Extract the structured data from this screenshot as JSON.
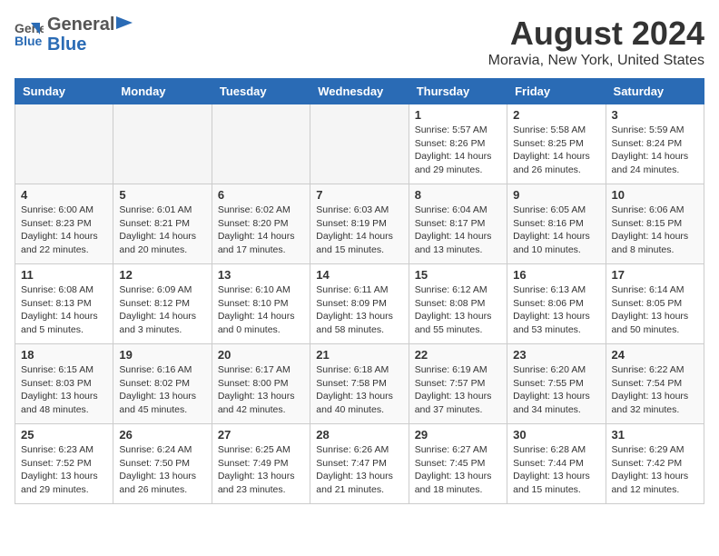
{
  "header": {
    "logo_general": "General",
    "logo_blue": "Blue",
    "month": "August 2024",
    "location": "Moravia, New York, United States"
  },
  "days_of_week": [
    "Sunday",
    "Monday",
    "Tuesday",
    "Wednesday",
    "Thursday",
    "Friday",
    "Saturday"
  ],
  "weeks": [
    [
      {
        "day": "",
        "info": ""
      },
      {
        "day": "",
        "info": ""
      },
      {
        "day": "",
        "info": ""
      },
      {
        "day": "",
        "info": ""
      },
      {
        "day": "1",
        "info": "Sunrise: 5:57 AM\nSunset: 8:26 PM\nDaylight: 14 hours\nand 29 minutes."
      },
      {
        "day": "2",
        "info": "Sunrise: 5:58 AM\nSunset: 8:25 PM\nDaylight: 14 hours\nand 26 minutes."
      },
      {
        "day": "3",
        "info": "Sunrise: 5:59 AM\nSunset: 8:24 PM\nDaylight: 14 hours\nand 24 minutes."
      }
    ],
    [
      {
        "day": "4",
        "info": "Sunrise: 6:00 AM\nSunset: 8:23 PM\nDaylight: 14 hours\nand 22 minutes."
      },
      {
        "day": "5",
        "info": "Sunrise: 6:01 AM\nSunset: 8:21 PM\nDaylight: 14 hours\nand 20 minutes."
      },
      {
        "day": "6",
        "info": "Sunrise: 6:02 AM\nSunset: 8:20 PM\nDaylight: 14 hours\nand 17 minutes."
      },
      {
        "day": "7",
        "info": "Sunrise: 6:03 AM\nSunset: 8:19 PM\nDaylight: 14 hours\nand 15 minutes."
      },
      {
        "day": "8",
        "info": "Sunrise: 6:04 AM\nSunset: 8:17 PM\nDaylight: 14 hours\nand 13 minutes."
      },
      {
        "day": "9",
        "info": "Sunrise: 6:05 AM\nSunset: 8:16 PM\nDaylight: 14 hours\nand 10 minutes."
      },
      {
        "day": "10",
        "info": "Sunrise: 6:06 AM\nSunset: 8:15 PM\nDaylight: 14 hours\nand 8 minutes."
      }
    ],
    [
      {
        "day": "11",
        "info": "Sunrise: 6:08 AM\nSunset: 8:13 PM\nDaylight: 14 hours\nand 5 minutes."
      },
      {
        "day": "12",
        "info": "Sunrise: 6:09 AM\nSunset: 8:12 PM\nDaylight: 14 hours\nand 3 minutes."
      },
      {
        "day": "13",
        "info": "Sunrise: 6:10 AM\nSunset: 8:10 PM\nDaylight: 14 hours\nand 0 minutes."
      },
      {
        "day": "14",
        "info": "Sunrise: 6:11 AM\nSunset: 8:09 PM\nDaylight: 13 hours\nand 58 minutes."
      },
      {
        "day": "15",
        "info": "Sunrise: 6:12 AM\nSunset: 8:08 PM\nDaylight: 13 hours\nand 55 minutes."
      },
      {
        "day": "16",
        "info": "Sunrise: 6:13 AM\nSunset: 8:06 PM\nDaylight: 13 hours\nand 53 minutes."
      },
      {
        "day": "17",
        "info": "Sunrise: 6:14 AM\nSunset: 8:05 PM\nDaylight: 13 hours\nand 50 minutes."
      }
    ],
    [
      {
        "day": "18",
        "info": "Sunrise: 6:15 AM\nSunset: 8:03 PM\nDaylight: 13 hours\nand 48 minutes."
      },
      {
        "day": "19",
        "info": "Sunrise: 6:16 AM\nSunset: 8:02 PM\nDaylight: 13 hours\nand 45 minutes."
      },
      {
        "day": "20",
        "info": "Sunrise: 6:17 AM\nSunset: 8:00 PM\nDaylight: 13 hours\nand 42 minutes."
      },
      {
        "day": "21",
        "info": "Sunrise: 6:18 AM\nSunset: 7:58 PM\nDaylight: 13 hours\nand 40 minutes."
      },
      {
        "day": "22",
        "info": "Sunrise: 6:19 AM\nSunset: 7:57 PM\nDaylight: 13 hours\nand 37 minutes."
      },
      {
        "day": "23",
        "info": "Sunrise: 6:20 AM\nSunset: 7:55 PM\nDaylight: 13 hours\nand 34 minutes."
      },
      {
        "day": "24",
        "info": "Sunrise: 6:22 AM\nSunset: 7:54 PM\nDaylight: 13 hours\nand 32 minutes."
      }
    ],
    [
      {
        "day": "25",
        "info": "Sunrise: 6:23 AM\nSunset: 7:52 PM\nDaylight: 13 hours\nand 29 minutes."
      },
      {
        "day": "26",
        "info": "Sunrise: 6:24 AM\nSunset: 7:50 PM\nDaylight: 13 hours\nand 26 minutes."
      },
      {
        "day": "27",
        "info": "Sunrise: 6:25 AM\nSunset: 7:49 PM\nDaylight: 13 hours\nand 23 minutes."
      },
      {
        "day": "28",
        "info": "Sunrise: 6:26 AM\nSunset: 7:47 PM\nDaylight: 13 hours\nand 21 minutes."
      },
      {
        "day": "29",
        "info": "Sunrise: 6:27 AM\nSunset: 7:45 PM\nDaylight: 13 hours\nand 18 minutes."
      },
      {
        "day": "30",
        "info": "Sunrise: 6:28 AM\nSunset: 7:44 PM\nDaylight: 13 hours\nand 15 minutes."
      },
      {
        "day": "31",
        "info": "Sunrise: 6:29 AM\nSunset: 7:42 PM\nDaylight: 13 hours\nand 12 minutes."
      }
    ]
  ]
}
